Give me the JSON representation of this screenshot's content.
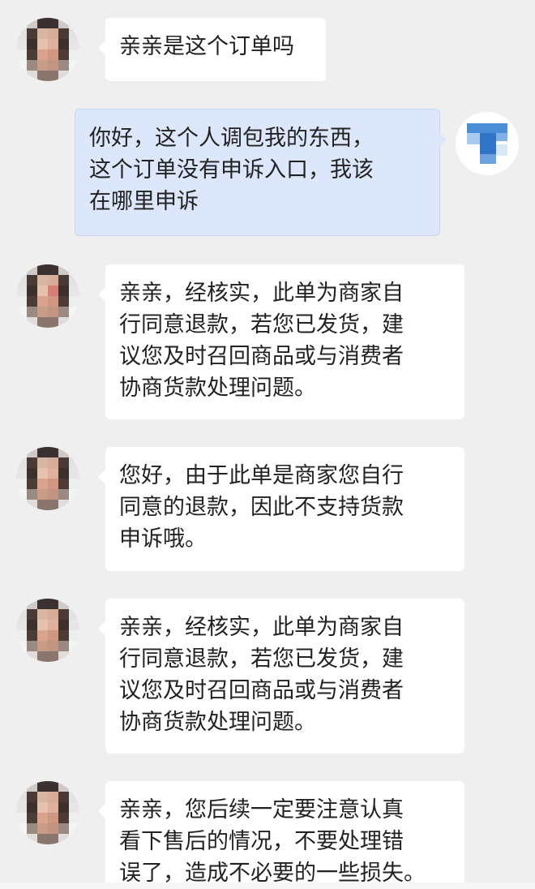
{
  "messages": [
    {
      "from": "agent",
      "text": "亲亲是这个订单吗"
    },
    {
      "from": "user",
      "text": "你好，这个人调包我的东西，\n这个订单没有申诉入口，我该\n在哪里申诉"
    },
    {
      "from": "agent",
      "text": "亲亲，经核实，此单为商家自\n行同意退款，若您已发货，建\n议您及时召回商品或与消费者\n协商货款处理问题。"
    },
    {
      "from": "agent",
      "text": "您好，由于此单是商家您自行\n同意的退款，因此不支持货款\n申诉哦。"
    },
    {
      "from": "agent",
      "text": "亲亲，经核实，此单为商家自\n行同意退款，若您已发货，建\n议您及时召回商品或与消费者\n协商货款处理问题。"
    },
    {
      "from": "agent",
      "text": "亲亲，您后续一定要注意认真\n看下售后的情况，不要处理错\n误了，造成不必要的一些损失。"
    }
  ],
  "avatars": {
    "agent": "pixelated-person-avatar",
    "user": "pixelated-blue-logo-avatar"
  },
  "colors": {
    "background": "#efefef",
    "incoming_bubble": "#ffffff",
    "outgoing_bubble": "#dde7fb",
    "text": "#222222"
  }
}
